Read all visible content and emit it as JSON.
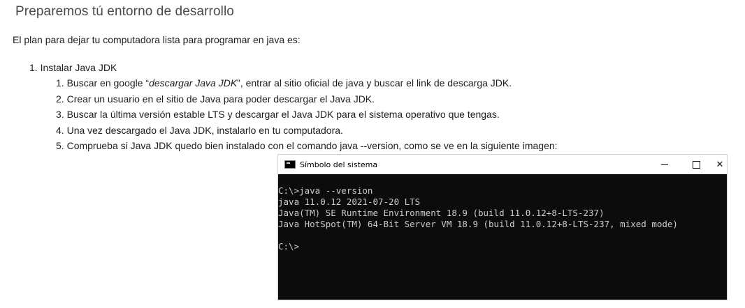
{
  "heading": "Preparemos tú entorno de desarrollo",
  "intro": "El plan para dejar tu computadora lista para programar en java es:",
  "steps": [
    {
      "number": "1.",
      "text": "Instalar Java JDK"
    }
  ],
  "substeps": [
    {
      "number": "1.",
      "before": "Buscar en google  “",
      "em": "descargar Java JDK",
      "after": "”, entrar al sitio oficial de java y buscar el link de descarga JDK."
    },
    {
      "number": "2.",
      "text": "Crear un usuario en el sitio de Java para poder descargar el Java JDK."
    },
    {
      "number": "3.",
      "text": "Buscar la última versión estable LTS y descargar el Java JDK para el sistema operativo que tengas."
    },
    {
      "number": "4.",
      "text": "Una vez descargado el Java JDK, instalarlo en tu computadora."
    },
    {
      "number": "5.",
      "text": "Comprueba si Java JDK quedo bien instalado con el comando  java --version, como se ve en la siguiente imagen:"
    }
  ],
  "console": {
    "title": "Símbolo del sistema",
    "icon": "console-app-icon",
    "buttons": {
      "minimize": "minimize-icon",
      "maximize": "maximize-icon",
      "close": "close-icon"
    },
    "lines": [
      "C:\\>java --version",
      "java 11.0.12 2021-07-20 LTS",
      "Java(TM) SE Runtime Environment 18.9 (build 11.0.12+8-LTS-237)",
      "Java HotSpot(TM) 64-Bit Server VM 18.9 (build 11.0.12+8-LTS-237, mixed mode)",
      "",
      "C:\\>"
    ]
  },
  "colors": {
    "heading": "#4a4a4a",
    "terminal_bg": "#0c0c0c",
    "terminal_fg": "#cccccc"
  }
}
